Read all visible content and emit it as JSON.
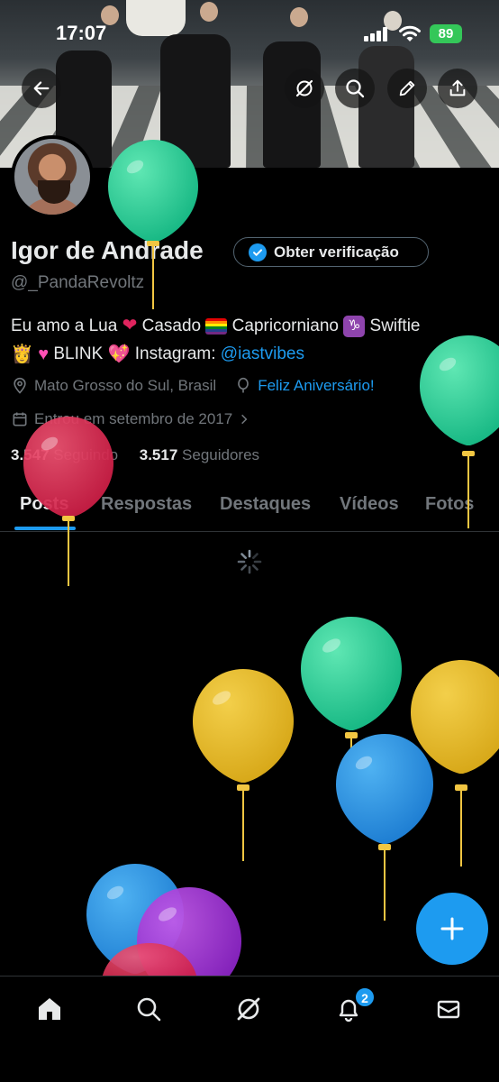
{
  "status_bar": {
    "time": "17:07",
    "battery": "89"
  },
  "header_actions": {
    "back": "back-arrow-icon",
    "grok": "grok-icon",
    "search": "search-icon",
    "edit": "edit-icon",
    "share": "share-icon"
  },
  "profile": {
    "name": "Igor de Andrade",
    "handle": "@_PandaRevoltz",
    "verify_button": "Obter verificação",
    "bio_part1": "Eu amo a Lua ",
    "bio_part2": " Casado ",
    "bio_part3": " Capricorniano ",
    "bio_part4": " Swiftie ",
    "bio_part5": " BLINK ",
    "bio_part6": " Instagram: ",
    "bio_link": "@iastvibes",
    "location": "Mato Grosso do Sul, Brasil",
    "birthday": "Feliz Aniversário!",
    "joined": "Entrou em setembro de 2017",
    "following_count": "3.547",
    "following_label": "Seguindo",
    "followers_count": "3.517",
    "followers_label": "Seguidores"
  },
  "tabs": [
    "Posts",
    "Respostas",
    "Destaques",
    "Vídeos",
    "Fotos"
  ],
  "bottom_nav": {
    "notifications_count": "2"
  },
  "colors": {
    "accent": "#1d9bf0",
    "verify_badge": "#1d9bf0",
    "battery": "#34c759"
  }
}
